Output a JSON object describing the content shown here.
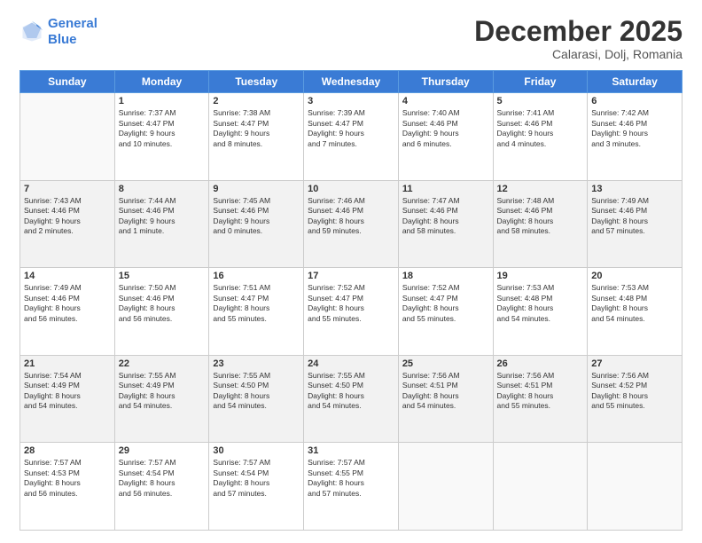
{
  "header": {
    "logo_line1": "General",
    "logo_line2": "Blue",
    "month": "December 2025",
    "location": "Calarasi, Dolj, Romania"
  },
  "days_of_week": [
    "Sunday",
    "Monday",
    "Tuesday",
    "Wednesday",
    "Thursday",
    "Friday",
    "Saturday"
  ],
  "weeks": [
    [
      {
        "day": "",
        "text": ""
      },
      {
        "day": "1",
        "text": "Sunrise: 7:37 AM\nSunset: 4:47 PM\nDaylight: 9 hours\nand 10 minutes."
      },
      {
        "day": "2",
        "text": "Sunrise: 7:38 AM\nSunset: 4:47 PM\nDaylight: 9 hours\nand 8 minutes."
      },
      {
        "day": "3",
        "text": "Sunrise: 7:39 AM\nSunset: 4:47 PM\nDaylight: 9 hours\nand 7 minutes."
      },
      {
        "day": "4",
        "text": "Sunrise: 7:40 AM\nSunset: 4:46 PM\nDaylight: 9 hours\nand 6 minutes."
      },
      {
        "day": "5",
        "text": "Sunrise: 7:41 AM\nSunset: 4:46 PM\nDaylight: 9 hours\nand 4 minutes."
      },
      {
        "day": "6",
        "text": "Sunrise: 7:42 AM\nSunset: 4:46 PM\nDaylight: 9 hours\nand 3 minutes."
      }
    ],
    [
      {
        "day": "7",
        "text": "Sunrise: 7:43 AM\nSunset: 4:46 PM\nDaylight: 9 hours\nand 2 minutes."
      },
      {
        "day": "8",
        "text": "Sunrise: 7:44 AM\nSunset: 4:46 PM\nDaylight: 9 hours\nand 1 minute."
      },
      {
        "day": "9",
        "text": "Sunrise: 7:45 AM\nSunset: 4:46 PM\nDaylight: 9 hours\nand 0 minutes."
      },
      {
        "day": "10",
        "text": "Sunrise: 7:46 AM\nSunset: 4:46 PM\nDaylight: 8 hours\nand 59 minutes."
      },
      {
        "day": "11",
        "text": "Sunrise: 7:47 AM\nSunset: 4:46 PM\nDaylight: 8 hours\nand 58 minutes."
      },
      {
        "day": "12",
        "text": "Sunrise: 7:48 AM\nSunset: 4:46 PM\nDaylight: 8 hours\nand 58 minutes."
      },
      {
        "day": "13",
        "text": "Sunrise: 7:49 AM\nSunset: 4:46 PM\nDaylight: 8 hours\nand 57 minutes."
      }
    ],
    [
      {
        "day": "14",
        "text": "Sunrise: 7:49 AM\nSunset: 4:46 PM\nDaylight: 8 hours\nand 56 minutes."
      },
      {
        "day": "15",
        "text": "Sunrise: 7:50 AM\nSunset: 4:46 PM\nDaylight: 8 hours\nand 56 minutes."
      },
      {
        "day": "16",
        "text": "Sunrise: 7:51 AM\nSunset: 4:47 PM\nDaylight: 8 hours\nand 55 minutes."
      },
      {
        "day": "17",
        "text": "Sunrise: 7:52 AM\nSunset: 4:47 PM\nDaylight: 8 hours\nand 55 minutes."
      },
      {
        "day": "18",
        "text": "Sunrise: 7:52 AM\nSunset: 4:47 PM\nDaylight: 8 hours\nand 55 minutes."
      },
      {
        "day": "19",
        "text": "Sunrise: 7:53 AM\nSunset: 4:48 PM\nDaylight: 8 hours\nand 54 minutes."
      },
      {
        "day": "20",
        "text": "Sunrise: 7:53 AM\nSunset: 4:48 PM\nDaylight: 8 hours\nand 54 minutes."
      }
    ],
    [
      {
        "day": "21",
        "text": "Sunrise: 7:54 AM\nSunset: 4:49 PM\nDaylight: 8 hours\nand 54 minutes."
      },
      {
        "day": "22",
        "text": "Sunrise: 7:55 AM\nSunset: 4:49 PM\nDaylight: 8 hours\nand 54 minutes."
      },
      {
        "day": "23",
        "text": "Sunrise: 7:55 AM\nSunset: 4:50 PM\nDaylight: 8 hours\nand 54 minutes."
      },
      {
        "day": "24",
        "text": "Sunrise: 7:55 AM\nSunset: 4:50 PM\nDaylight: 8 hours\nand 54 minutes."
      },
      {
        "day": "25",
        "text": "Sunrise: 7:56 AM\nSunset: 4:51 PM\nDaylight: 8 hours\nand 54 minutes."
      },
      {
        "day": "26",
        "text": "Sunrise: 7:56 AM\nSunset: 4:51 PM\nDaylight: 8 hours\nand 55 minutes."
      },
      {
        "day": "27",
        "text": "Sunrise: 7:56 AM\nSunset: 4:52 PM\nDaylight: 8 hours\nand 55 minutes."
      }
    ],
    [
      {
        "day": "28",
        "text": "Sunrise: 7:57 AM\nSunset: 4:53 PM\nDaylight: 8 hours\nand 56 minutes."
      },
      {
        "day": "29",
        "text": "Sunrise: 7:57 AM\nSunset: 4:54 PM\nDaylight: 8 hours\nand 56 minutes."
      },
      {
        "day": "30",
        "text": "Sunrise: 7:57 AM\nSunset: 4:54 PM\nDaylight: 8 hours\nand 57 minutes."
      },
      {
        "day": "31",
        "text": "Sunrise: 7:57 AM\nSunset: 4:55 PM\nDaylight: 8 hours\nand 57 minutes."
      },
      {
        "day": "",
        "text": ""
      },
      {
        "day": "",
        "text": ""
      },
      {
        "day": "",
        "text": ""
      }
    ]
  ]
}
